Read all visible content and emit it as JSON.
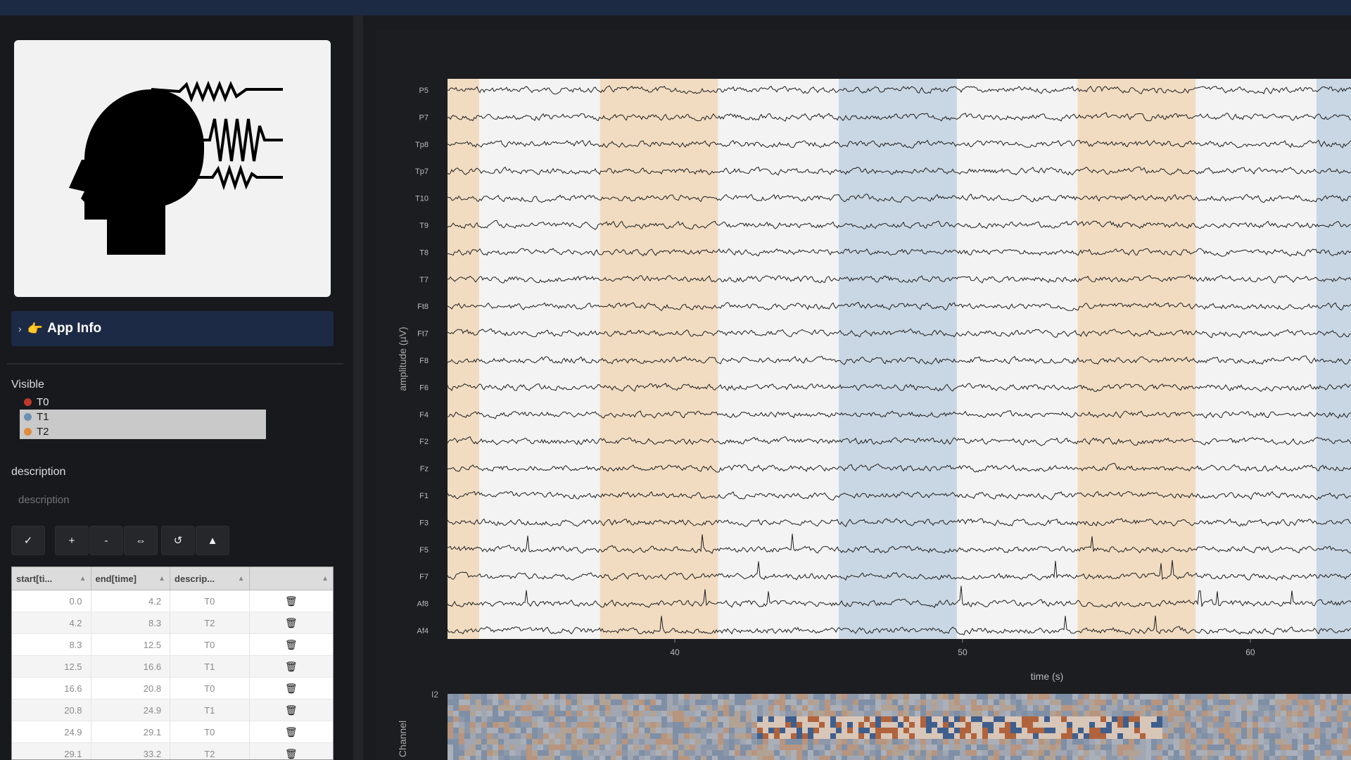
{
  "sidebar": {
    "app_info_label": "App Info",
    "visible_label": "Visible",
    "visible_items": [
      {
        "label": "T0",
        "color": "#c0392b",
        "selected": false
      },
      {
        "label": "T1",
        "color": "#6d8fb3",
        "selected": true
      },
      {
        "label": "T2",
        "color": "#e08a3c",
        "selected": true
      }
    ],
    "description_label": "description",
    "description_placeholder": "description",
    "toolbar_buttons": [
      "✓",
      "+",
      "-",
      "⇔",
      "↺",
      "▲"
    ],
    "table": {
      "headers": [
        "start[ti...",
        "end[time]",
        "descrip..."
      ],
      "rows": [
        {
          "start": "0.0",
          "end": "4.2",
          "desc": "T0"
        },
        {
          "start": "4.2",
          "end": "8.3",
          "desc": "T2"
        },
        {
          "start": "8.3",
          "end": "12.5",
          "desc": "T0"
        },
        {
          "start": "12.5",
          "end": "16.6",
          "desc": "T1"
        },
        {
          "start": "16.6",
          "end": "20.8",
          "desc": "T0"
        },
        {
          "start": "20.8",
          "end": "24.9",
          "desc": "T1"
        },
        {
          "start": "24.9",
          "end": "29.1",
          "desc": "T0"
        },
        {
          "start": "29.1",
          "end": "33.2",
          "desc": "T2"
        }
      ]
    }
  },
  "colors": {
    "t1_band": "#c9d7e4",
    "t2_band": "#f1dcc2",
    "trace": "#1e1e1e"
  },
  "chart_data": {
    "type": "line",
    "xlabel": "time (s)",
    "ylabel": "amplitude (µV)",
    "x_ticks": [
      40,
      50,
      60
    ],
    "xlim": [
      32.1,
      63.5
    ],
    "channels": [
      "P5",
      "P7",
      "Tp8",
      "Tp7",
      "T10",
      "T9",
      "T8",
      "T7",
      "Ft8",
      "Ft7",
      "F8",
      "F6",
      "F4",
      "F2",
      "Fz",
      "F1",
      "F3",
      "F5",
      "F7",
      "Af8",
      "Af4"
    ],
    "annotation_bands": [
      {
        "start": 32.1,
        "end": 33.2,
        "label": "T2"
      },
      {
        "start": 37.4,
        "end": 41.5,
        "label": "T2"
      },
      {
        "start": 45.7,
        "end": 49.8,
        "label": "T1"
      },
      {
        "start": 54.0,
        "end": 58.1,
        "label": "T2"
      },
      {
        "start": 62.3,
        "end": 63.5,
        "label": "T1"
      }
    ],
    "heatmap_ylabel": "Channel",
    "heatmap_ytick": "I2"
  }
}
